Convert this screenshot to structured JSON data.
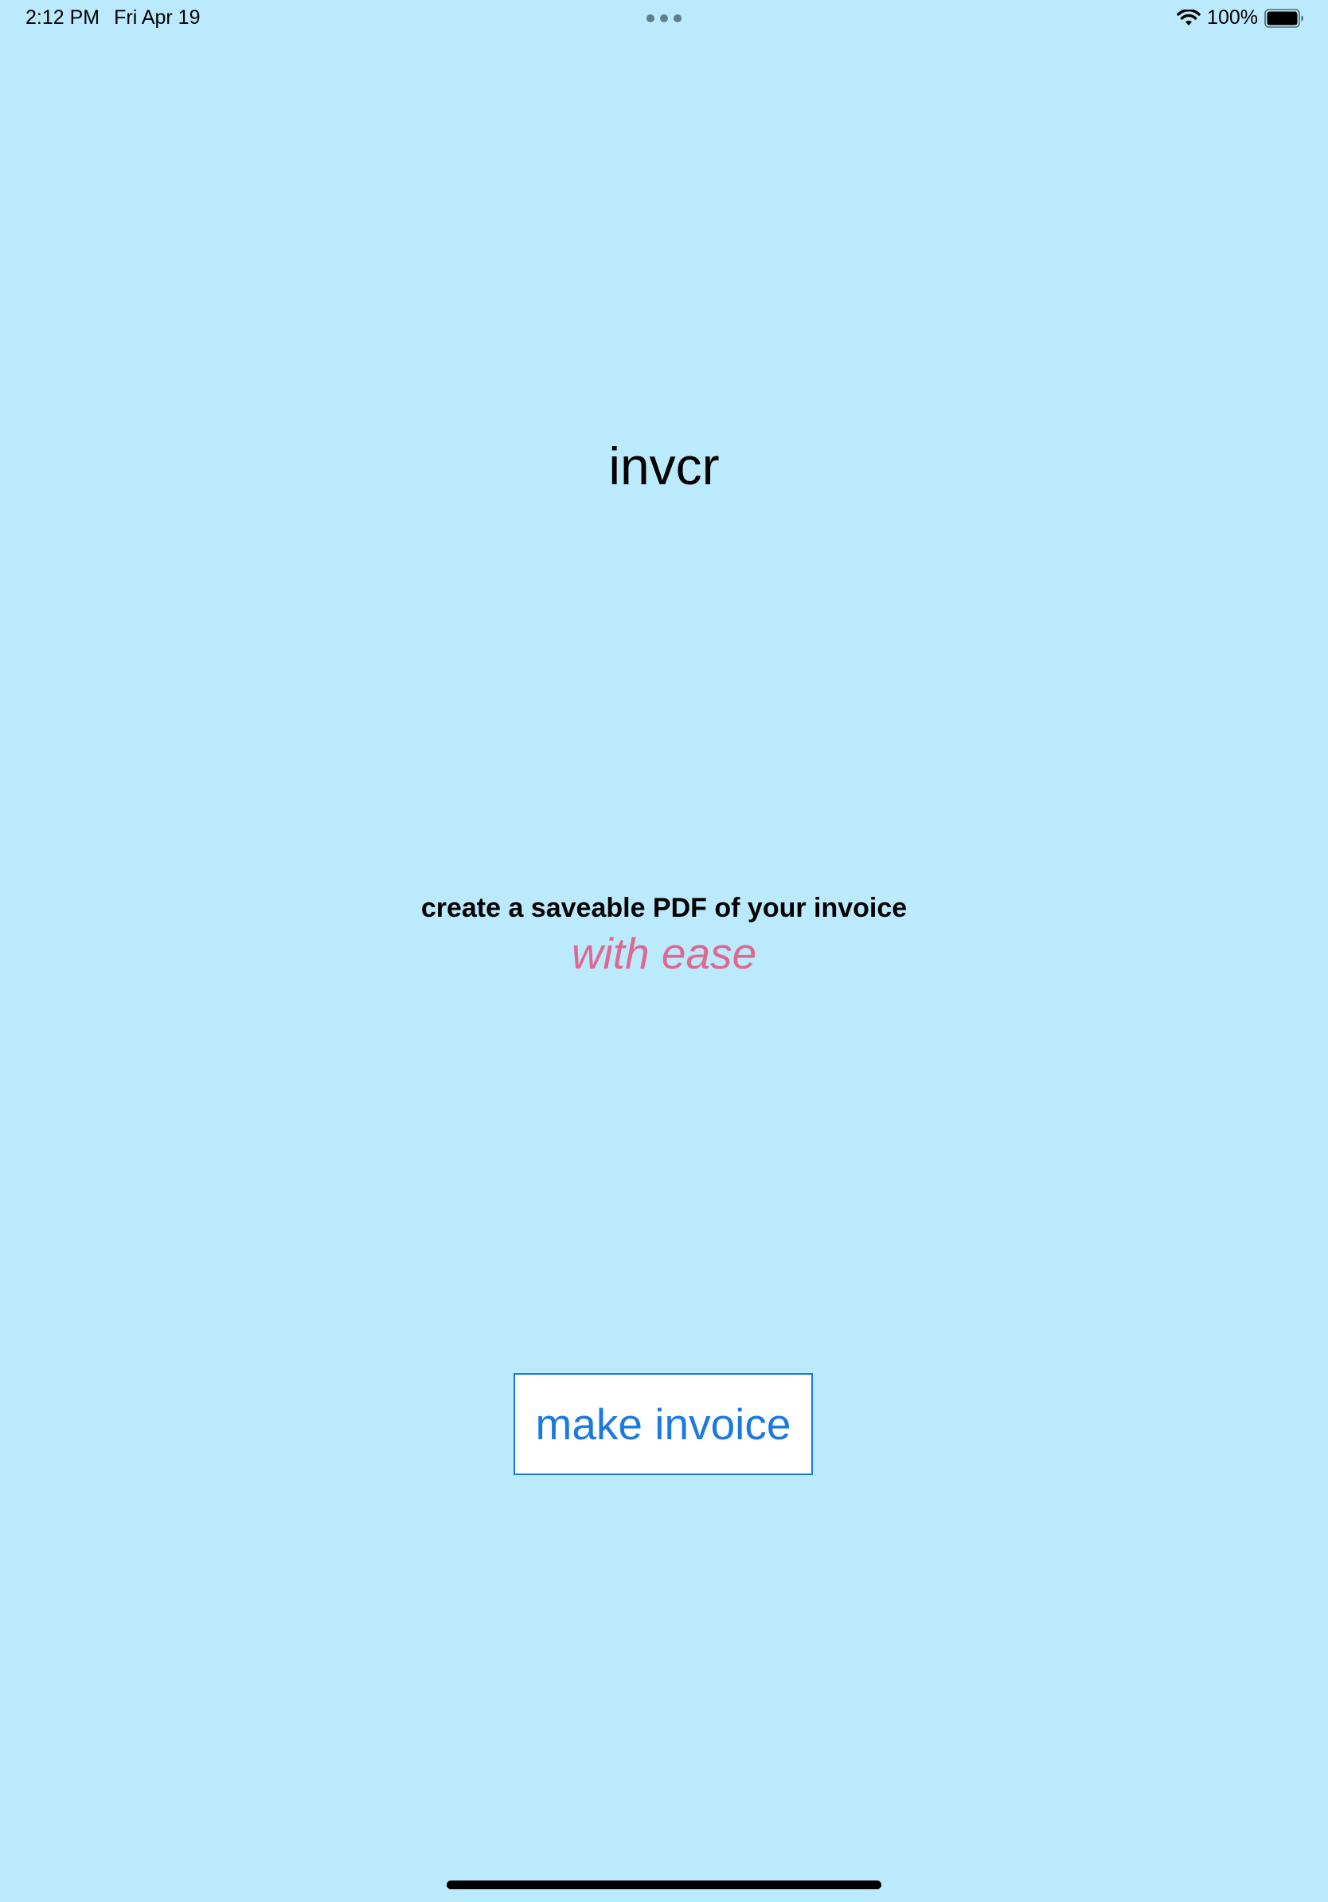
{
  "status_bar": {
    "time": "2:12 PM",
    "date": "Fri Apr 19",
    "battery_percent": "100%",
    "battery_level": 1.0,
    "icons": [
      "wifi-icon",
      "battery-icon"
    ]
  },
  "main": {
    "title": "invcr",
    "tagline": "create a saveable PDF of your invoice",
    "tagline_emphasis": "with ease",
    "make_invoice_label": "make invoice"
  },
  "colors": {
    "background": "#bbeafd",
    "accent": "#1b7ae0",
    "emphasis": "#de6890"
  }
}
